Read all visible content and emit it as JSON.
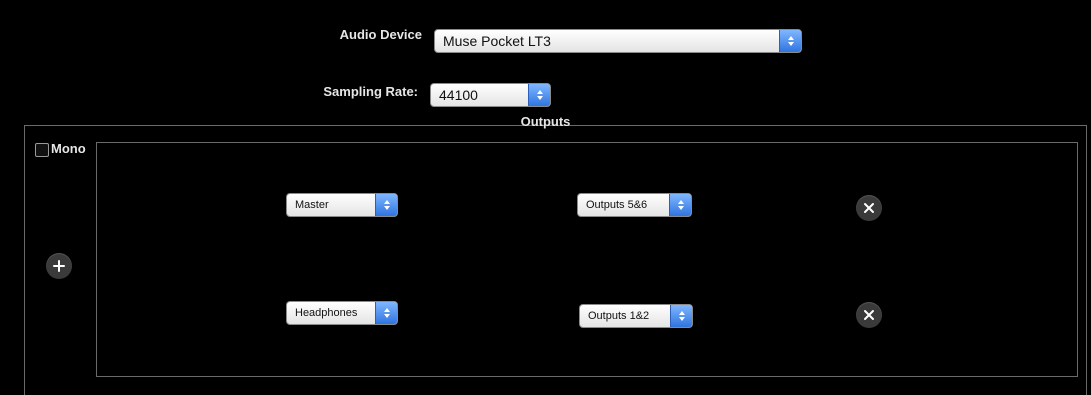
{
  "audio_device": {
    "label": "Audio Device",
    "selected": "Muse Pocket LT3"
  },
  "sampling_rate": {
    "label": "Sampling Rate:",
    "selected": "44100"
  },
  "outputs": {
    "title": "Outputs",
    "mono_label": "Mono",
    "mono_checked": false,
    "rows": [
      {
        "source": "Master",
        "destination": "Outputs 5&6"
      },
      {
        "source": "Headphones",
        "destination": "Outputs 1&2"
      }
    ]
  },
  "icons": {
    "add": "plus-icon",
    "remove": "close-icon",
    "stepper": "up-down-arrows-icon"
  },
  "colors": {
    "background": "#000000",
    "accent": "#3b82f0",
    "text": "#e6e6e6"
  }
}
